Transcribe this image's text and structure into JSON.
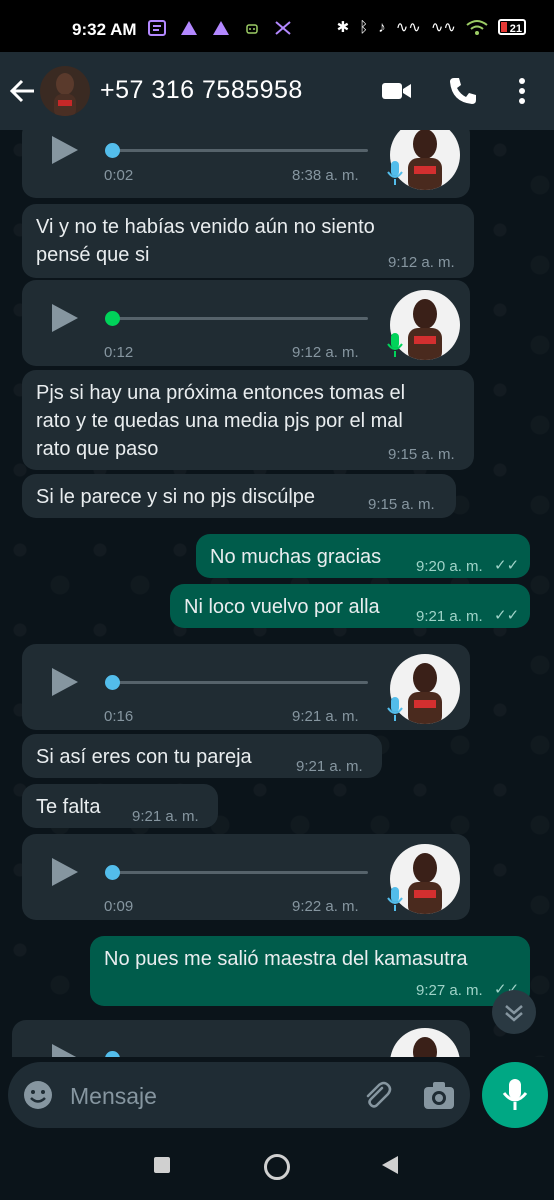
{
  "status": {
    "time": "9:32 AM",
    "battery": "21"
  },
  "header": {
    "contact": "+57 316 7585958"
  },
  "messages": [
    {
      "kind": "voice",
      "duration": "0:02",
      "time": "8:38 a. m."
    },
    {
      "kind": "text",
      "text_line1": "Vi y no te habías venido aún no siento",
      "text_line2": "pensé que si",
      "time": "9:12 a. m."
    },
    {
      "kind": "voice",
      "duration": "0:12",
      "time": "9:12 a. m."
    },
    {
      "kind": "text",
      "text_line1": "Pjs si hay una próxima entonces tomas el",
      "text_line2": "rato y te quedas una media pjs por el mal",
      "text_line3": "rato que paso",
      "time": "9:15 a. m."
    },
    {
      "kind": "text",
      "text": "Si le parece y si no pjs discúlpe",
      "time": "9:15 a. m."
    },
    {
      "kind": "out",
      "text": "No muchas gracias",
      "time": "9:20 a. m."
    },
    {
      "kind": "out",
      "text": "Ni loco vuelvo por alla",
      "time": "9:21 a. m."
    },
    {
      "kind": "voice",
      "duration": "0:16",
      "time": "9:21 a. m."
    },
    {
      "kind": "text",
      "text": "Si así eres con tu pareja",
      "time": "9:21 a. m."
    },
    {
      "kind": "text",
      "text": "Te falta",
      "time": "9:21 a. m."
    },
    {
      "kind": "voice",
      "duration": "0:09",
      "time": "9:22 a. m."
    },
    {
      "kind": "out",
      "text": "No pues me salió maestra del kamasutra",
      "time": "9:27 a. m."
    }
  ],
  "input": {
    "placeholder": "Mensaje"
  },
  "colors": {
    "incoming": "#202c33",
    "outgoing": "#005c4b",
    "accent": "#00a884",
    "played_dot": "#00d35a",
    "unplayed_dot": "#53bdeb"
  }
}
